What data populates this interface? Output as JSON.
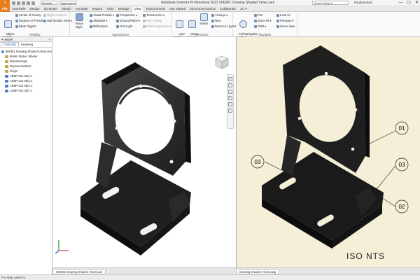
{
  "app": {
    "title": "Autodesk Inventor Professional 2022    506381 Drawing Shaded Views.iam",
    "file_button": "I",
    "material_select": "Material",
    "appearance_select": "Appearance",
    "search_placeholder": "Search Help & Commands...",
    "user": "PaulMunford",
    "window_controls": [
      "—",
      "▢",
      "✕"
    ]
  },
  "ribbon_tabs": [
    "File",
    "Assemble",
    "Design",
    "3D Model",
    "Sketch",
    "Annotate",
    "Inspect",
    "Tools",
    "Manage",
    "View",
    "Environments",
    "Get Started",
    "Electromechanical",
    "Collaborate",
    "ЭС ▾"
  ],
  "ribbon": {
    "visibility": {
      "label": "Visibility",
      "object_visibility": "Object\nVisibility",
      "items": [
        "Center of Gravity",
        "Degrees of Freedom",
        "iMate Glyphs",
        "Glyph Graphics",
        "Half Section View ▾"
      ]
    },
    "appearance": {
      "label": "Appearance",
      "visual_style": "Visual Style",
      "items": [
        "Visual Presets ▾",
        "Shadows ▾",
        "Reflections",
        "Perspective ▾",
        "Ground Plane ▾",
        "Grid Light",
        "Textures On ▾",
        "Ray Tracing",
        "Refine Appearance"
      ]
    },
    "windows": {
      "label": "Windows",
      "user_interface": "User\nInterface",
      "clean_screen": "Clean\nScreen",
      "switch": "Switch",
      "items": [
        "Arrange ▾",
        "New",
        "Reset UI Layout"
      ]
    },
    "navigate": {
      "label": "Navigate",
      "full_navigation_wheel": "Full Navigation\nWheel",
      "items": [
        "Pan",
        "Zoom All ▾",
        "Orbit ▾",
        "Look At",
        "Previous ▾",
        "Home View"
      ]
    }
  },
  "browser": {
    "header": "Model",
    "tabs": [
      "Assembly",
      "Modeling"
    ],
    "tree": [
      {
        "label": "506381 Drawing Shaded Views.iam",
        "level": 0,
        "color": "#6b8fbf"
      },
      {
        "label": "Model States: Master",
        "level": 1,
        "color": "#bfa76b"
      },
      {
        "label": "Relationships",
        "level": 1,
        "color": "#c9a24a"
      },
      {
        "label": "Representations",
        "level": 1,
        "color": "#c9a24a"
      },
      {
        "label": "Origin",
        "level": 1,
        "color": "#c9a24a"
      },
      {
        "label": "AD5R-011-28(1:1",
        "level": 1,
        "color": "#4f7fc0"
      },
      {
        "label": "AD5R-011-28(1:1",
        "level": 1,
        "color": "#4f7fc0"
      },
      {
        "label": "AD5R-011-28(7:1",
        "level": 1,
        "color": "#4f7fc0"
      },
      {
        "label": "AD5R-011-28(7:1",
        "level": 1,
        "color": "#4f7fc0"
      }
    ]
  },
  "document_tabs": [
    "506381 Drawing Shaded Views.iam",
    "Drawing Shaded Views.dwg"
  ],
  "status": "For Help, press F1",
  "drawing": {
    "view_label": "ISO  NTS",
    "balloons": [
      "01",
      "03",
      "03",
      "02"
    ]
  },
  "viewcube_label": "FRONT",
  "colors": {
    "accent": "#e87d1e",
    "sheet": "#f5efd8",
    "part": "#2b2b2b"
  }
}
